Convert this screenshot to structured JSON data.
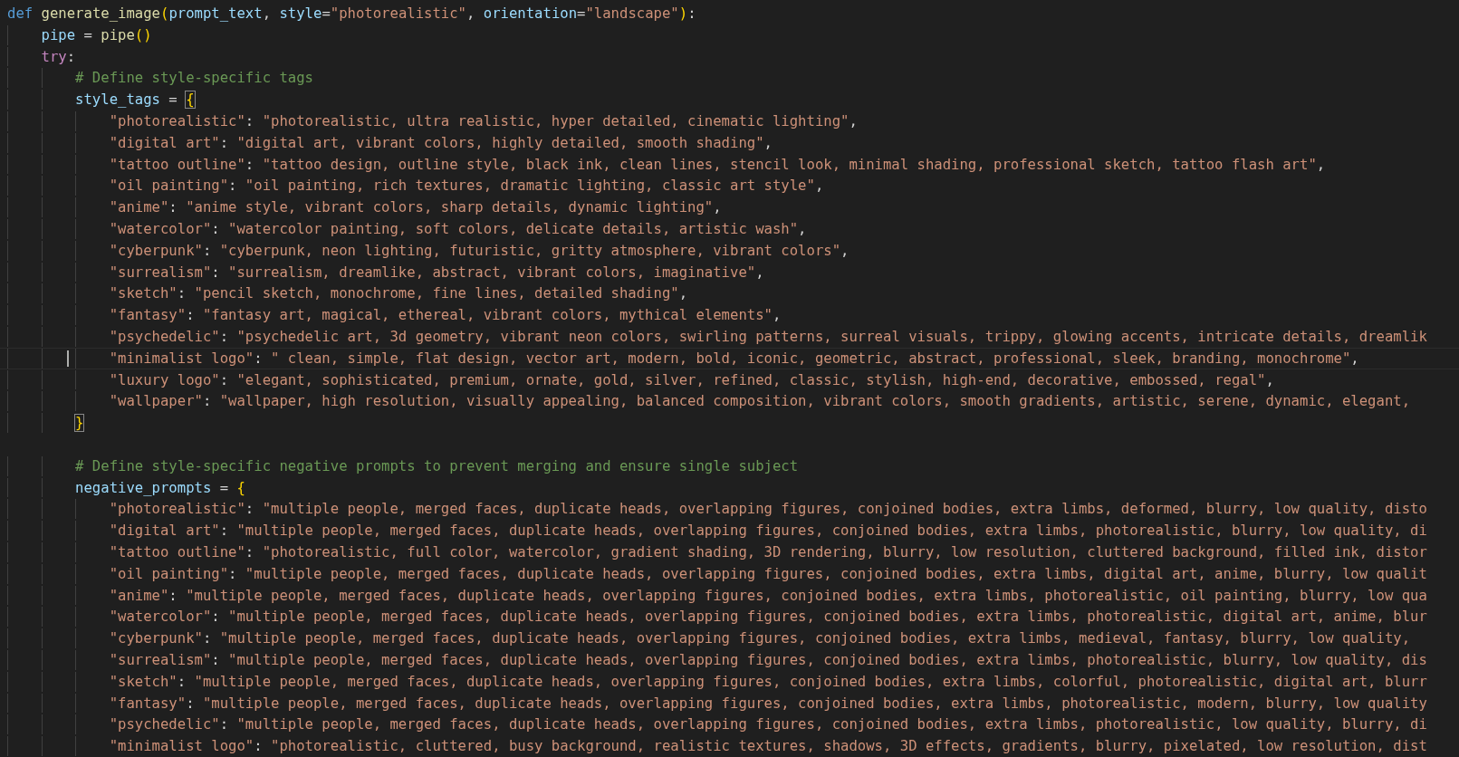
{
  "editor": {
    "lines": [
      {
        "tokens": [
          {
            "kind": "keyword",
            "text": "def"
          },
          {
            "kind": "function",
            "text": "generate_image"
          },
          {
            "kind": "paren",
            "text": "("
          },
          {
            "kind": "param",
            "text": "prompt_text"
          },
          {
            "kind": "plain",
            "text": ", "
          },
          {
            "kind": "param",
            "text": "style"
          },
          {
            "kind": "plain",
            "text": "="
          },
          {
            "kind": "string",
            "text": "\"photorealistic\""
          },
          {
            "kind": "plain",
            "text": ", "
          },
          {
            "kind": "param",
            "text": "orientation"
          },
          {
            "kind": "plain",
            "text": "="
          },
          {
            "kind": "string",
            "text": "\"landscape\""
          },
          {
            "kind": "paren",
            "text": ")"
          },
          {
            "kind": "plain",
            "text": ":"
          }
        ],
        "children": [
          {
            "tokens": [
              {
                "kind": "param",
                "text": "pipe"
              },
              {
                "kind": "plain",
                "text": " = "
              },
              {
                "kind": "function",
                "text": "pipe"
              },
              {
                "kind": "paren",
                "text": "()"
              }
            ]
          },
          {
            "tokens": [
              {
                "kind": "control",
                "text": "try"
              },
              {
                "kind": "plain",
                "text": ":"
              }
            ],
            "children": [
              {
                "tokens": [
                  {
                    "kind": "comment",
                    "text": "# Define style-specific tags"
                  }
                ]
              },
              {
                "tokens": [
                  {
                    "kind": "param",
                    "text": "style_tags"
                  },
                  {
                    "kind": "plain",
                    "text": " = "
                  },
                  {
                    "kind": "paren",
                    "text": "{",
                    "matched": true
                  }
                ],
                "children": [
                  {
                    "tokens": [
                      {
                        "kind": "string",
                        "text": "\"photorealistic\""
                      },
                      {
                        "kind": "plain",
                        "text": ": "
                      },
                      {
                        "kind": "string",
                        "text": "\"photorealistic, ultra realistic, hyper detailed, cinematic lighting\""
                      },
                      {
                        "kind": "plain",
                        "text": ","
                      }
                    ]
                  },
                  {
                    "tokens": [
                      {
                        "kind": "string",
                        "text": "\"digital art\""
                      },
                      {
                        "kind": "plain",
                        "text": ": "
                      },
                      {
                        "kind": "string",
                        "text": "\"digital art, vibrant colors, highly detailed, smooth shading\""
                      },
                      {
                        "kind": "plain",
                        "text": ","
                      }
                    ]
                  },
                  {
                    "tokens": [
                      {
                        "kind": "string",
                        "text": "\"tattoo outline\""
                      },
                      {
                        "kind": "plain",
                        "text": ": "
                      },
                      {
                        "kind": "string",
                        "text": "\"tattoo design, outline style, black ink, clean lines, stencil look, minimal shading, professional sketch, tattoo flash art\""
                      },
                      {
                        "kind": "plain",
                        "text": ","
                      }
                    ]
                  },
                  {
                    "tokens": [
                      {
                        "kind": "string",
                        "text": "\"oil painting\""
                      },
                      {
                        "kind": "plain",
                        "text": ": "
                      },
                      {
                        "kind": "string",
                        "text": "\"oil painting, rich textures, dramatic lighting, classic art style\""
                      },
                      {
                        "kind": "plain",
                        "text": ","
                      }
                    ]
                  },
                  {
                    "tokens": [
                      {
                        "kind": "string",
                        "text": "\"anime\""
                      },
                      {
                        "kind": "plain",
                        "text": ": "
                      },
                      {
                        "kind": "string",
                        "text": "\"anime style, vibrant colors, sharp details, dynamic lighting\""
                      },
                      {
                        "kind": "plain",
                        "text": ","
                      }
                    ]
                  },
                  {
                    "tokens": [
                      {
                        "kind": "string",
                        "text": "\"watercolor\""
                      },
                      {
                        "kind": "plain",
                        "text": ": "
                      },
                      {
                        "kind": "string",
                        "text": "\"watercolor painting, soft colors, delicate details, artistic wash\""
                      },
                      {
                        "kind": "plain",
                        "text": ","
                      }
                    ]
                  },
                  {
                    "tokens": [
                      {
                        "kind": "string",
                        "text": "\"cyberpunk\""
                      },
                      {
                        "kind": "plain",
                        "text": ": "
                      },
                      {
                        "kind": "string",
                        "text": "\"cyberpunk, neon lighting, futuristic, gritty atmosphere, vibrant colors\""
                      },
                      {
                        "kind": "plain",
                        "text": ","
                      }
                    ]
                  },
                  {
                    "tokens": [
                      {
                        "kind": "string",
                        "text": "\"surrealism\""
                      },
                      {
                        "kind": "plain",
                        "text": ": "
                      },
                      {
                        "kind": "string",
                        "text": "\"surrealism, dreamlike, abstract, vibrant colors, imaginative\""
                      },
                      {
                        "kind": "plain",
                        "text": ","
                      }
                    ]
                  },
                  {
                    "tokens": [
                      {
                        "kind": "string",
                        "text": "\"sketch\""
                      },
                      {
                        "kind": "plain",
                        "text": ": "
                      },
                      {
                        "kind": "string",
                        "text": "\"pencil sketch, monochrome, fine lines, detailed shading\""
                      },
                      {
                        "kind": "plain",
                        "text": ","
                      }
                    ]
                  },
                  {
                    "tokens": [
                      {
                        "kind": "string",
                        "text": "\"fantasy\""
                      },
                      {
                        "kind": "plain",
                        "text": ": "
                      },
                      {
                        "kind": "string",
                        "text": "\"fantasy art, magical, ethereal, vibrant colors, mythical elements\""
                      },
                      {
                        "kind": "plain",
                        "text": ","
                      }
                    ]
                  },
                  {
                    "tokens": [
                      {
                        "kind": "string",
                        "text": "\"psychedelic\""
                      },
                      {
                        "kind": "plain",
                        "text": ": "
                      },
                      {
                        "kind": "string",
                        "text": "\"psychedelic art, 3d geometry, vibrant neon colors, swirling patterns, surreal visuals, trippy, glowing accents, intricate details, dreamlik"
                      }
                    ]
                  },
                  {
                    "current": true,
                    "tokens": [
                      {
                        "kind": "string",
                        "text": "\"minimalist logo\""
                      },
                      {
                        "kind": "plain",
                        "text": ": "
                      },
                      {
                        "kind": "string",
                        "text": "\" clean, simple, flat design, vector art, modern, bold, iconic, geometric, abstract, professional, sleek, branding, monochrome\""
                      },
                      {
                        "kind": "plain",
                        "text": ","
                      }
                    ]
                  },
                  {
                    "tokens": [
                      {
                        "kind": "string",
                        "text": "\"luxury logo\""
                      },
                      {
                        "kind": "plain",
                        "text": ": "
                      },
                      {
                        "kind": "string",
                        "text": "\"elegant, sophisticated, premium, ornate, gold, silver, refined, classic, stylish, high-end, decorative, embossed, regal\""
                      },
                      {
                        "kind": "plain",
                        "text": ","
                      }
                    ]
                  },
                  {
                    "tokens": [
                      {
                        "kind": "string",
                        "text": "\"wallpaper\""
                      },
                      {
                        "kind": "plain",
                        "text": ": "
                      },
                      {
                        "kind": "string",
                        "text": "\"wallpaper, high resolution, visually appealing, balanced composition, vibrant colors, smooth gradients, artistic, serene, dynamic, elegant,"
                      }
                    ]
                  }
                ]
              },
              {
                "tokens": [
                  {
                    "kind": "paren",
                    "text": "}",
                    "matched": true
                  }
                ]
              },
              {
                "kind": "blank"
              },
              {
                "tokens": [
                  {
                    "kind": "comment",
                    "text": "# Define style-specific negative prompts to prevent merging and ensure single subject"
                  }
                ]
              },
              {
                "tokens": [
                  {
                    "kind": "param",
                    "text": "negative_prompts"
                  },
                  {
                    "kind": "plain",
                    "text": " = "
                  },
                  {
                    "kind": "paren",
                    "text": "{",
                    "matched": false
                  }
                ],
                "children": [
                  {
                    "tokens": [
                      {
                        "kind": "string",
                        "text": "\"photorealistic\""
                      },
                      {
                        "kind": "plain",
                        "text": ": "
                      },
                      {
                        "kind": "string",
                        "text": "\"multiple people, merged faces, duplicate heads, overlapping figures, conjoined bodies, extra limbs, deformed, blurry, low quality, disto"
                      }
                    ]
                  },
                  {
                    "tokens": [
                      {
                        "kind": "string",
                        "text": "\"digital art\""
                      },
                      {
                        "kind": "plain",
                        "text": ": "
                      },
                      {
                        "kind": "string",
                        "text": "\"multiple people, merged faces, duplicate heads, overlapping figures, conjoined bodies, extra limbs, photorealistic, blurry, low quality, di"
                      }
                    ]
                  },
                  {
                    "tokens": [
                      {
                        "kind": "string",
                        "text": "\"tattoo outline\""
                      },
                      {
                        "kind": "plain",
                        "text": ": "
                      },
                      {
                        "kind": "string",
                        "text": "\"photorealistic, full color, watercolor, gradient shading, 3D rendering, blurry, low resolution, cluttered background, filled ink, distor"
                      }
                    ]
                  },
                  {
                    "tokens": [
                      {
                        "kind": "string",
                        "text": "\"oil painting\""
                      },
                      {
                        "kind": "plain",
                        "text": ": "
                      },
                      {
                        "kind": "string",
                        "text": "\"multiple people, merged faces, duplicate heads, overlapping figures, conjoined bodies, extra limbs, digital art, anime, blurry, low qualit"
                      }
                    ]
                  },
                  {
                    "tokens": [
                      {
                        "kind": "string",
                        "text": "\"anime\""
                      },
                      {
                        "kind": "plain",
                        "text": ": "
                      },
                      {
                        "kind": "string",
                        "text": "\"multiple people, merged faces, duplicate heads, overlapping figures, conjoined bodies, extra limbs, photorealistic, oil painting, blurry, low qua"
                      }
                    ]
                  },
                  {
                    "tokens": [
                      {
                        "kind": "string",
                        "text": "\"watercolor\""
                      },
                      {
                        "kind": "plain",
                        "text": ": "
                      },
                      {
                        "kind": "string",
                        "text": "\"multiple people, merged faces, duplicate heads, overlapping figures, conjoined bodies, extra limbs, photorealistic, digital art, anime, blur"
                      }
                    ]
                  },
                  {
                    "tokens": [
                      {
                        "kind": "string",
                        "text": "\"cyberpunk\""
                      },
                      {
                        "kind": "plain",
                        "text": ": "
                      },
                      {
                        "kind": "string",
                        "text": "\"multiple people, merged faces, duplicate heads, overlapping figures, conjoined bodies, extra limbs, medieval, fantasy, blurry, low quality,"
                      }
                    ]
                  },
                  {
                    "tokens": [
                      {
                        "kind": "string",
                        "text": "\"surrealism\""
                      },
                      {
                        "kind": "plain",
                        "text": ": "
                      },
                      {
                        "kind": "string",
                        "text": "\"multiple people, merged faces, duplicate heads, overlapping figures, conjoined bodies, extra limbs, photorealistic, blurry, low quality, dis"
                      }
                    ]
                  },
                  {
                    "tokens": [
                      {
                        "kind": "string",
                        "text": "\"sketch\""
                      },
                      {
                        "kind": "plain",
                        "text": ": "
                      },
                      {
                        "kind": "string",
                        "text": "\"multiple people, merged faces, duplicate heads, overlapping figures, conjoined bodies, extra limbs, colorful, photorealistic, digital art, blurr"
                      }
                    ]
                  },
                  {
                    "tokens": [
                      {
                        "kind": "string",
                        "text": "\"fantasy\""
                      },
                      {
                        "kind": "plain",
                        "text": ": "
                      },
                      {
                        "kind": "string",
                        "text": "\"multiple people, merged faces, duplicate heads, overlapping figures, conjoined bodies, extra limbs, photorealistic, modern, blurry, low quality"
                      }
                    ]
                  },
                  {
                    "tokens": [
                      {
                        "kind": "string",
                        "text": "\"psychedelic\""
                      },
                      {
                        "kind": "plain",
                        "text": ": "
                      },
                      {
                        "kind": "string",
                        "text": "\"multiple people, merged faces, duplicate heads, overlapping figures, conjoined bodies, extra limbs, photorealistic, low quality, blurry, di"
                      }
                    ]
                  },
                  {
                    "tokens": [
                      {
                        "kind": "string",
                        "text": "\"minimalist logo\""
                      },
                      {
                        "kind": "plain",
                        "text": ": "
                      },
                      {
                        "kind": "string",
                        "text": "\"photorealistic, cluttered, busy background, realistic textures, shadows, 3D effects, gradients, blurry, pixelated, low resolution, dist"
                      }
                    ]
                  }
                ]
              }
            ]
          }
        ]
      }
    ]
  }
}
